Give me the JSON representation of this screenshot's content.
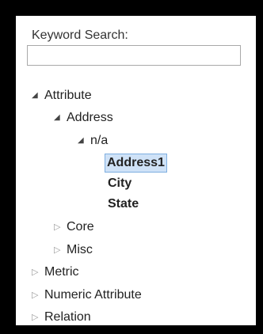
{
  "search": {
    "label": "Keyword Search:",
    "value": "",
    "placeholder": ""
  },
  "tree": {
    "attribute": "Attribute",
    "address": "Address",
    "na": "n/a",
    "address1": "Address1",
    "city": "City",
    "state": "State",
    "core": "Core",
    "misc": "Misc",
    "metric": "Metric",
    "numeric_attribute": "Numeric Attribute",
    "relation": "Relation"
  },
  "icons": {
    "expanded": "triangle-expanded-icon",
    "collapsed": "triangle-collapsed-icon"
  },
  "colors": {
    "frame": "#000000",
    "selection_bg": "#cfe2f7",
    "selection_border": "#7eaee0"
  }
}
